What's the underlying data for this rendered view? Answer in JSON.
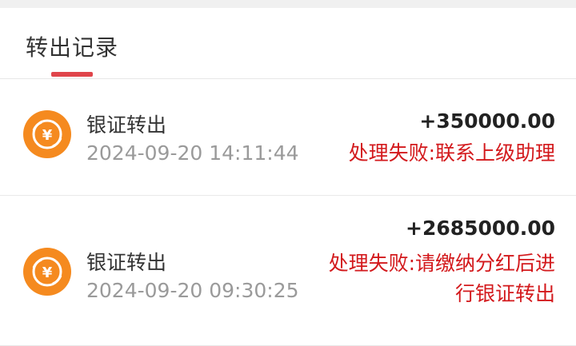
{
  "header": {
    "title": "转出记录"
  },
  "records": [
    {
      "title": "银证转出",
      "time": "2024-09-20 14:11:44",
      "amount": "+350000.00",
      "status": "处理失败:联系上级助理",
      "icon": "yuan-coin-icon"
    },
    {
      "title": "银证转出",
      "time": "2024-09-20 09:30:25",
      "amount": "+2685000.00",
      "status": "处理失败:请缴纳分红后进行银证转出",
      "icon": "yuan-coin-icon"
    }
  ],
  "colors": {
    "accent": "#e0454b",
    "error": "#d3191c",
    "coin": "#f58a1f"
  }
}
